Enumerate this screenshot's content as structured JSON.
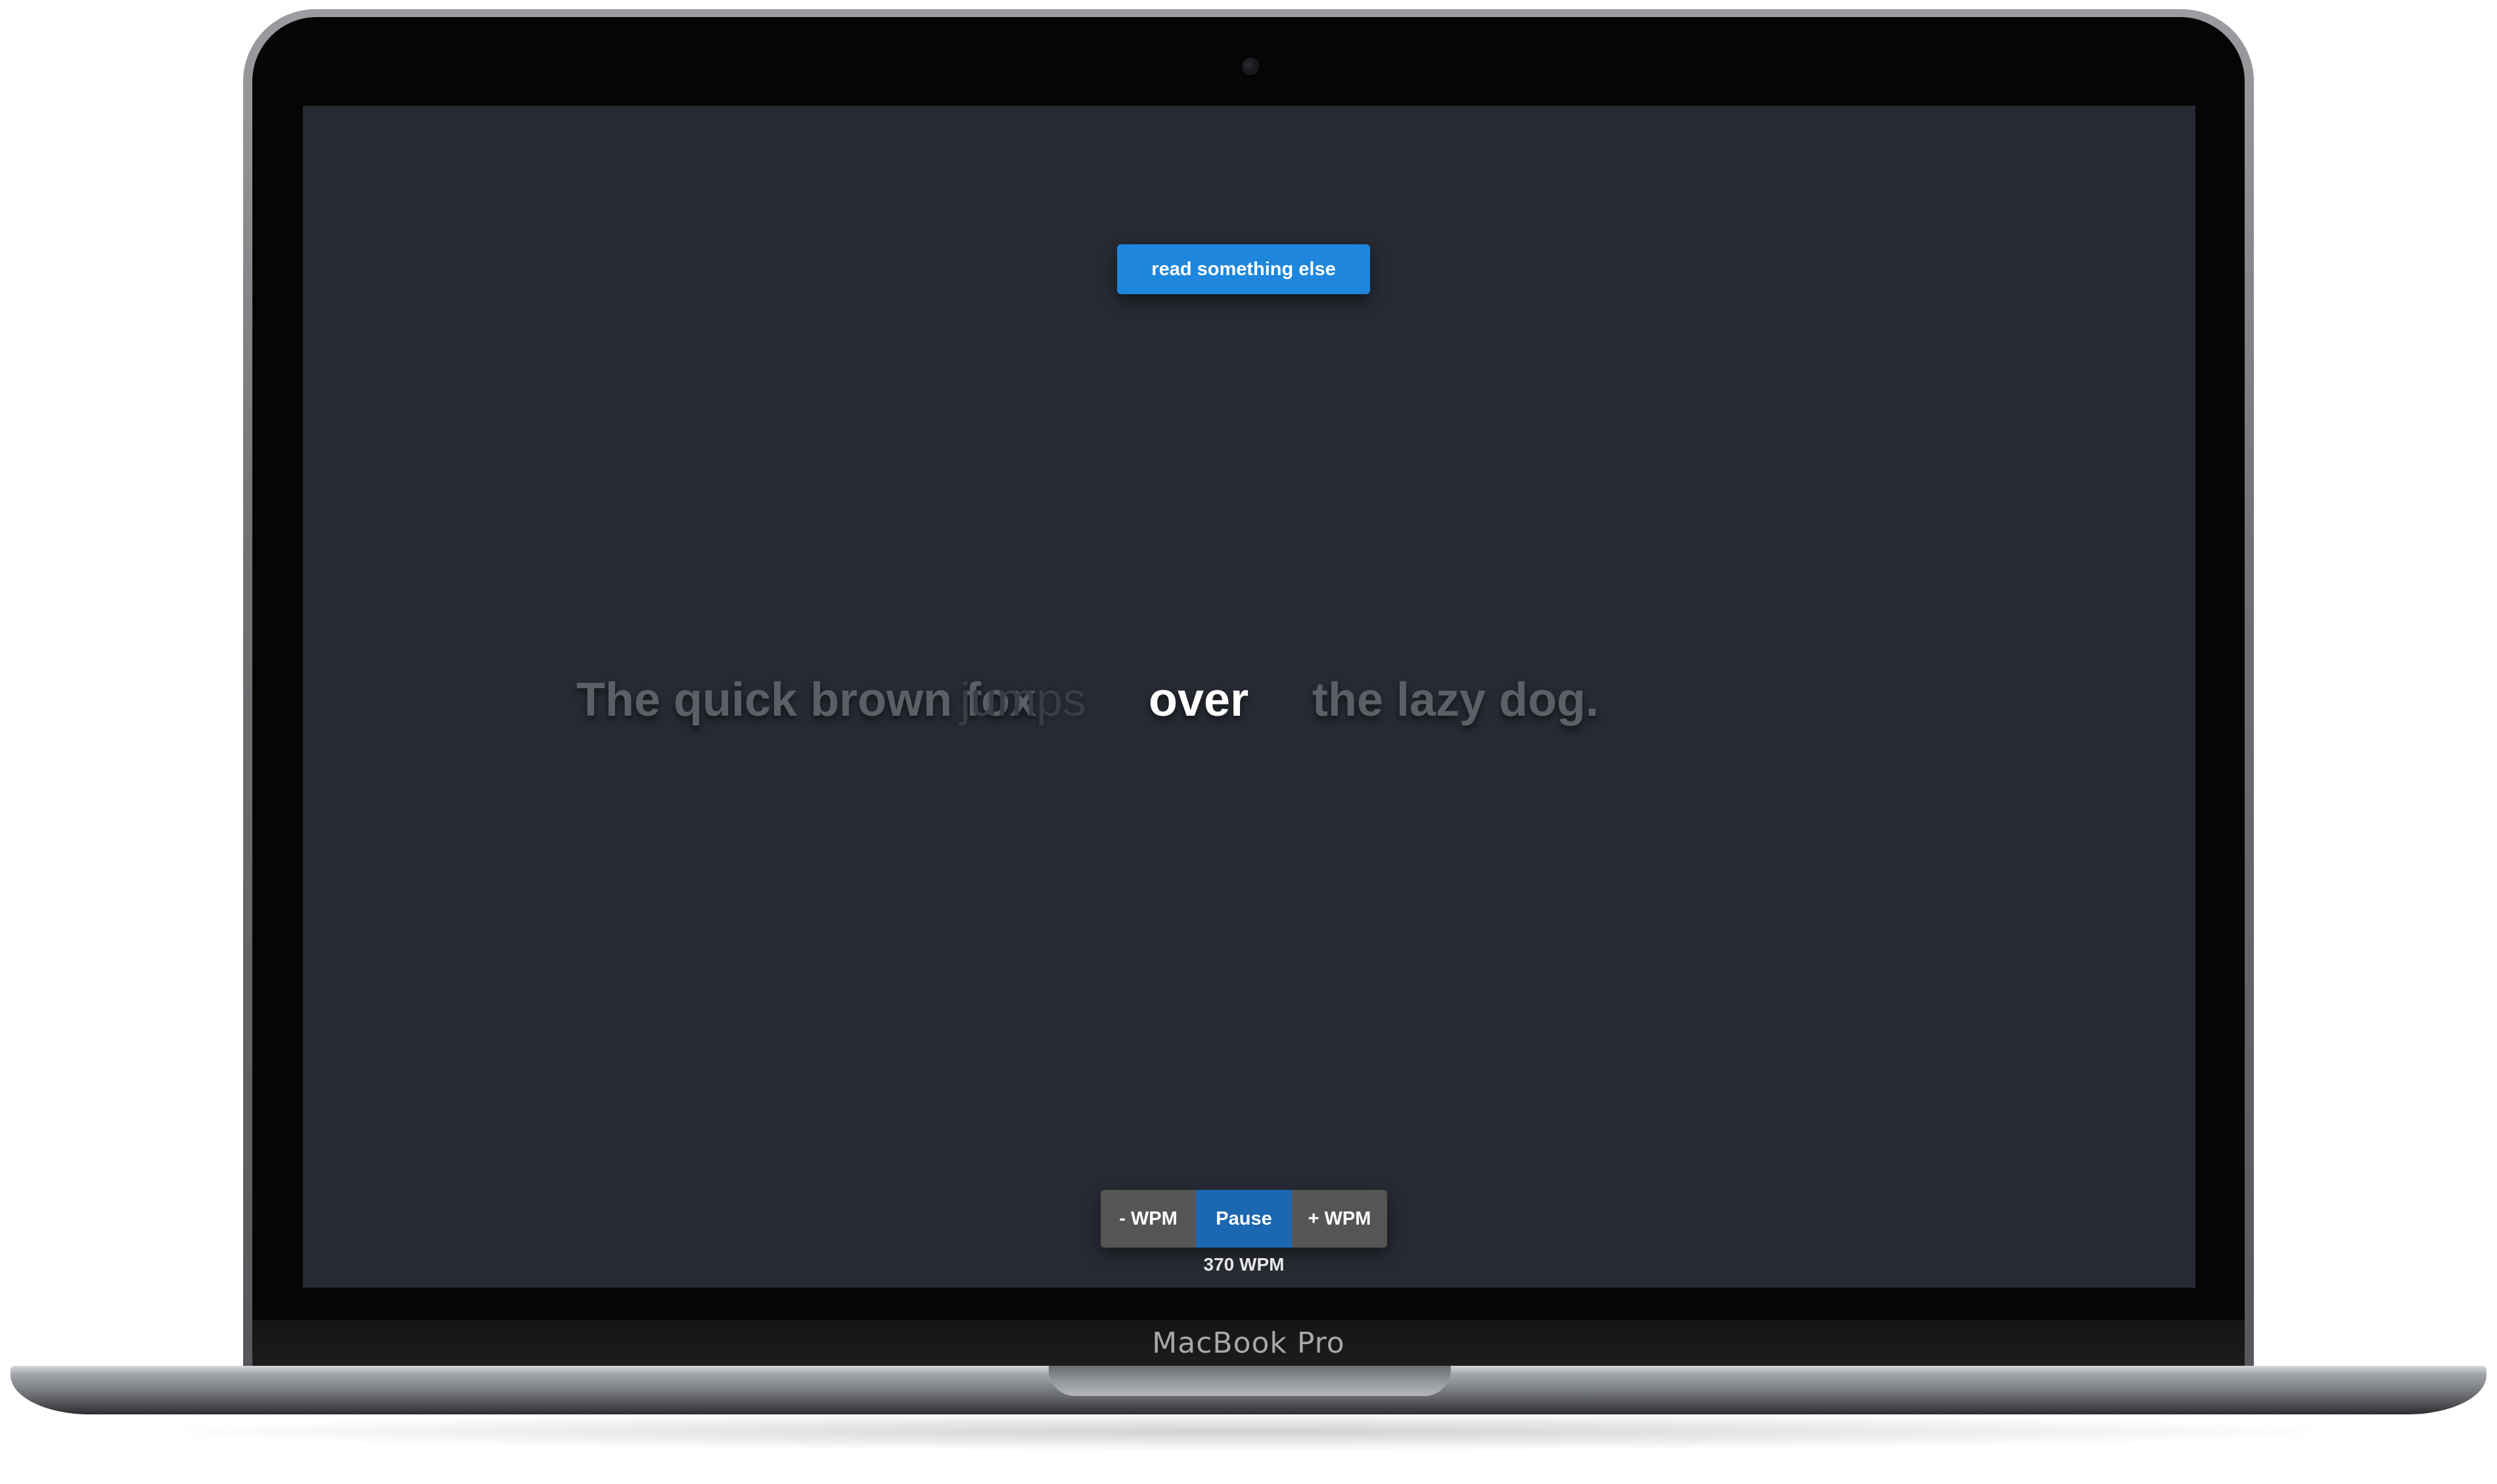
{
  "device": {
    "brand_label": "MacBook Pro"
  },
  "app": {
    "read_else_button": "read something else",
    "reader": {
      "words_before": "The quick brown fox",
      "previous_word": "jumps",
      "current_word": "over",
      "words_after": "the lazy dog."
    },
    "controls": {
      "decrease_label": "- WPM",
      "pause_label": "Pause",
      "increase_label": "+ WPM",
      "wpm_readout": "370 WPM"
    },
    "colors": {
      "background": "#272a33",
      "primary_button": "#1e86dc",
      "pause_button": "#1b67b1",
      "secondary_button": "#555555",
      "dim_text": "#5c5f66",
      "current_word": "#ffffff"
    }
  }
}
